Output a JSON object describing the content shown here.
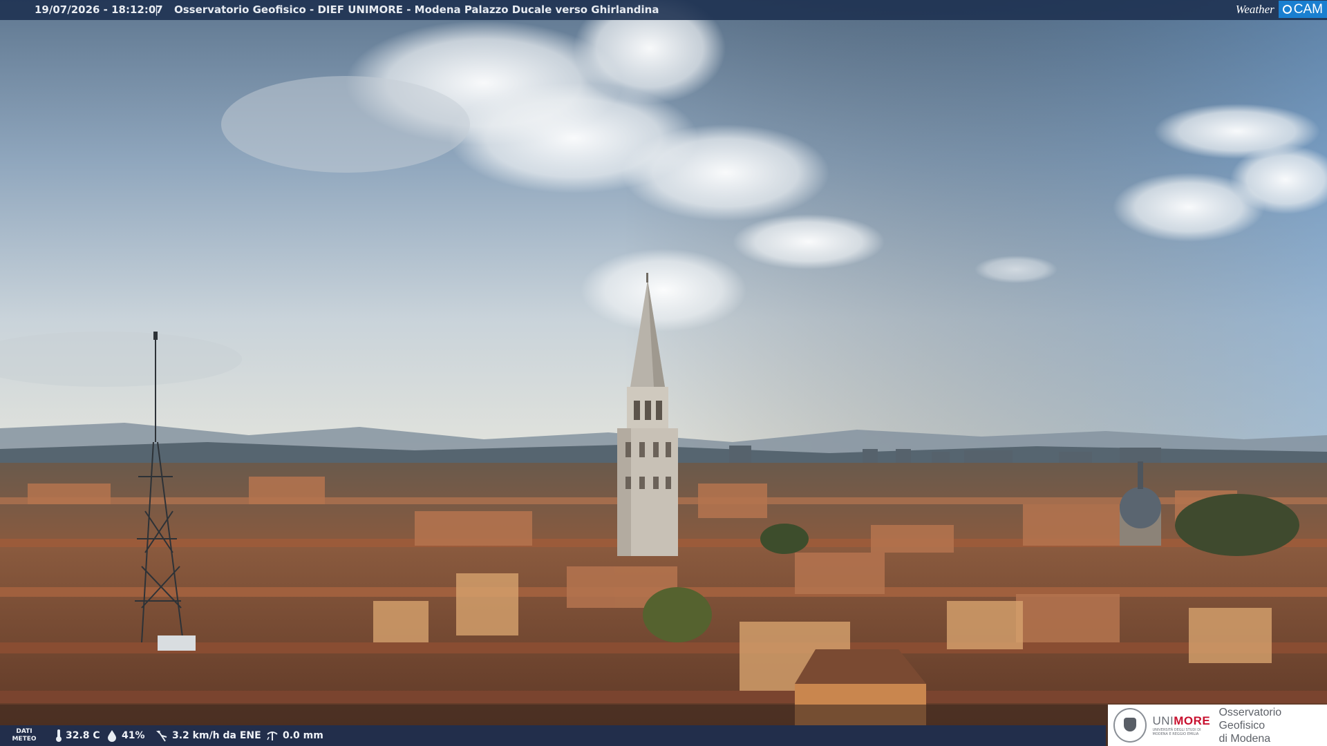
{
  "caption": {
    "timestamp": "19/07/2026 - 18:12:07",
    "separator": "|",
    "title": "Osservatorio Geofisico - DIEF UNIMORE - Modena Palazzo Ducale verso Ghirlandina"
  },
  "brand": {
    "word": "Weather",
    "cam": "CAM"
  },
  "meteo": {
    "label_line1": "DATI",
    "label_line2": "METEO",
    "temperature": "32.8 C",
    "humidity": "41%",
    "wind": "3.2 km/h da ENE",
    "rain": "0.0 mm",
    "icons": [
      "thermometer-icon",
      "humidity-icon",
      "wind-icon",
      "rain-gauge-icon"
    ]
  },
  "logo": {
    "uni_part1": "UNI",
    "uni_part2": "MORE",
    "uni_subtitle": "UNIVERSITÀ DEGLI STUDI DI MODENA E REGGIO EMILIA",
    "obs_line1": "Osservatorio Geofisico",
    "obs_line2": "di Modena"
  },
  "colors": {
    "bar": "#1c3050",
    "brand_blue": "#1a7fd0",
    "unimore_red": "#c8102e",
    "roof_terracotta": "#9a5a3c",
    "sky_blue": "#7fa3c8"
  }
}
